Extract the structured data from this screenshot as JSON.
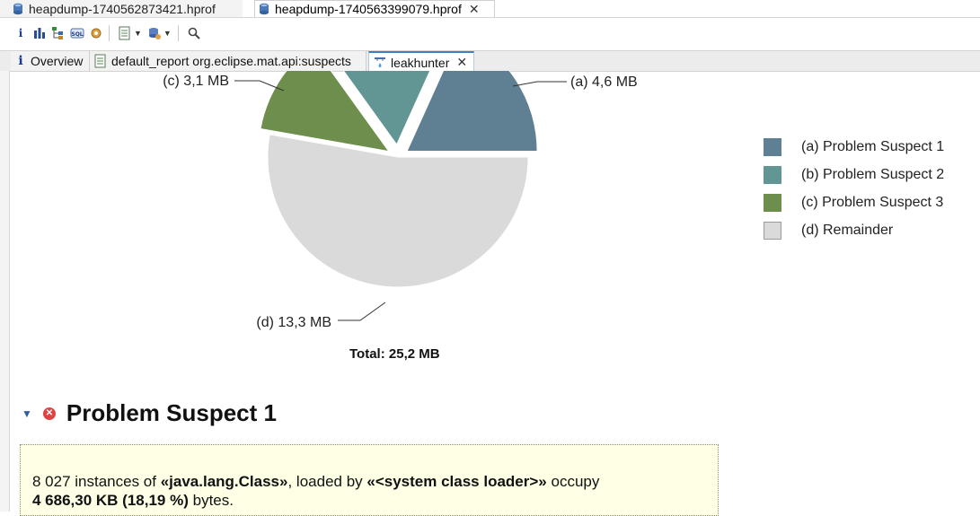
{
  "editor_tabs": [
    {
      "label": "heapdump-1740562873421.hprof",
      "active": false
    },
    {
      "label": "heapdump-1740563399079.hprof",
      "active": true
    }
  ],
  "close_glyph": "✕",
  "report_tabs": [
    {
      "label": "Overview"
    },
    {
      "label": "default_report org.eclipse.mat.api:suspects"
    },
    {
      "label": "leakhunter"
    }
  ],
  "chart_data": {
    "type": "pie",
    "slices": [
      {
        "key": "a",
        "label": "(a)  4,6 MB",
        "value": 4.6,
        "color": "#5f7f92",
        "legend": "(a)  Problem Suspect 1"
      },
      {
        "key": "b",
        "label": "",
        "value": 4.2,
        "color": "#629695",
        "legend": "(b)  Problem Suspect 2"
      },
      {
        "key": "c",
        "label": "(c)  3,1 MB",
        "value": 3.1,
        "color": "#6d8e4c",
        "legend": "(c)  Problem Suspect 3"
      },
      {
        "key": "d",
        "label": "(d)  13,3 MB",
        "value": 13.3,
        "color": "#dadada",
        "legend": "(d)  Remainder"
      }
    ],
    "total_label": "Total: 25,2 MB"
  },
  "suspect": {
    "title": "Problem Suspect 1",
    "desc_pre": "8 027 instances of ",
    "desc_class": "«java.lang.Class»",
    "desc_mid": ", loaded by ",
    "desc_loader": "«<system class loader>»",
    "desc_occupy": " occupy",
    "desc_size": "4 686,30 KB (18,19 %)",
    "desc_post": " bytes."
  }
}
